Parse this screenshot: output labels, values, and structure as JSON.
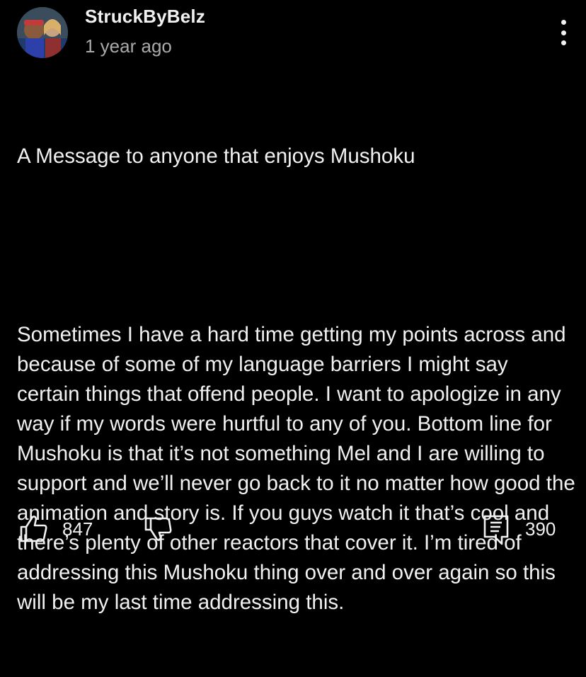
{
  "comment": {
    "author": "StruckByBelz",
    "timestamp": "1 year ago",
    "title": "A Message to anyone that enjoys Mushoku",
    "body": "Sometimes I have a hard time getting my points across and because of some of my language barriers I might say certain things that offend people. I want to apologize in any way if my words were hurtful to any of you. Bottom line for Mushoku is that it’s not something Mel and I are willing to support and we’ll never go back to it no matter how good the animation and story is. If you guys watch it that’s cool and there’s plenty of other reactors that cover it. I’m tired of addressing this Mushoku thing over and over again so this will be my last time addressing this."
  },
  "actions": {
    "like_count": "847",
    "reply_count": "390",
    "like_icon": "thumbs-up-icon",
    "dislike_icon": "thumbs-down-icon",
    "replies_icon": "comment-icon",
    "more_icon": "more-vertical-icon"
  },
  "colors": {
    "background": "#000000",
    "primary_text": "#f1f1f1",
    "secondary_text": "#aaaaaa"
  }
}
